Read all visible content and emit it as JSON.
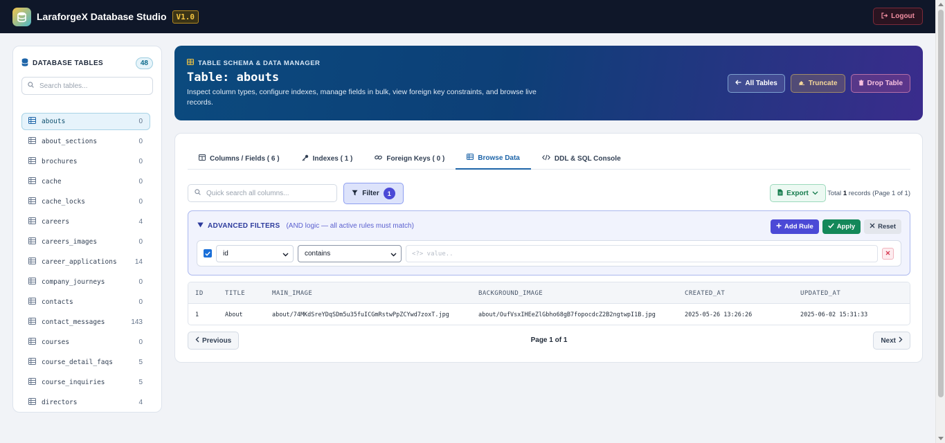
{
  "app": {
    "title": "LaraforgeX Database Studio",
    "version": "V1.0",
    "logout": "Logout"
  },
  "sidebar": {
    "title": "DATABASE TABLES",
    "count": "48",
    "search_placeholder": "Search tables...",
    "items": [
      {
        "name": "abouts",
        "count": "0"
      },
      {
        "name": "about_sections",
        "count": "0"
      },
      {
        "name": "brochures",
        "count": "0"
      },
      {
        "name": "cache",
        "count": "0"
      },
      {
        "name": "cache_locks",
        "count": "0"
      },
      {
        "name": "careers",
        "count": "4"
      },
      {
        "name": "careers_images",
        "count": "0"
      },
      {
        "name": "career_applications",
        "count": "14"
      },
      {
        "name": "company_journeys",
        "count": "0"
      },
      {
        "name": "contacts",
        "count": "0"
      },
      {
        "name": "contact_messages",
        "count": "143"
      },
      {
        "name": "courses",
        "count": "0"
      },
      {
        "name": "course_detail_faqs",
        "count": "5"
      },
      {
        "name": "course_inquiries",
        "count": "5"
      },
      {
        "name": "directors",
        "count": "4"
      }
    ]
  },
  "banner": {
    "eyebrow": "TABLE SCHEMA & DATA MANAGER",
    "title": "Table: abouts",
    "description": "Inspect column types, configure indexes, manage fields in bulk, view foreign key constraints, and browse live records.",
    "all_tables": "All Tables",
    "truncate": "Truncate",
    "drop_table": "Drop Table"
  },
  "tabs": [
    {
      "label": "Columns / Fields ( 6 )"
    },
    {
      "label": "Indexes ( 1 )"
    },
    {
      "label": "Foreign Keys ( 0 )"
    },
    {
      "label": "Browse Data"
    },
    {
      "label": "DDL & SQL Console"
    }
  ],
  "toolbar": {
    "search_placeholder": "Quick search all columns...",
    "filter_label": "Filter",
    "filter_count": "1",
    "export_label": "Export",
    "total_prefix": "Total ",
    "total_count": "1",
    "total_suffix": " records (Page 1 of 1)"
  },
  "advanced_filters": {
    "title": "ADVANCED FILTERS",
    "subtitle": "(AND logic — all active rules must match)",
    "add_rule": "Add Rule",
    "apply": "Apply",
    "reset": "Reset",
    "rule": {
      "field": "id",
      "operator": "contains",
      "value_placeholder": "<?> value.."
    }
  },
  "table": {
    "headers": [
      "ID",
      "TITLE",
      "MAIN_IMAGE",
      "BACKGROUND_IMAGE",
      "CREATED_AT",
      "UPDATED_AT"
    ],
    "rows": [
      [
        "1",
        "About",
        "about/74MKdSreYDqSDm5u35fuICGmRstwPpZCYwd7zoxT.jpg",
        "about/OufVsxIHEeZlGbho68gB7fopocdcZ2B2ngtwpI1B.jpg",
        "2025-05-26 13:26:26",
        "2025-06-02 15:31:33"
      ]
    ]
  },
  "pager": {
    "prev": "Previous",
    "page_text": "Page 1 of 1",
    "next": "Next"
  },
  "colors": {
    "topbar": "#0f1729",
    "accent": "#1d64a8",
    "filter": "#4b49d6",
    "apply": "#14885a"
  }
}
